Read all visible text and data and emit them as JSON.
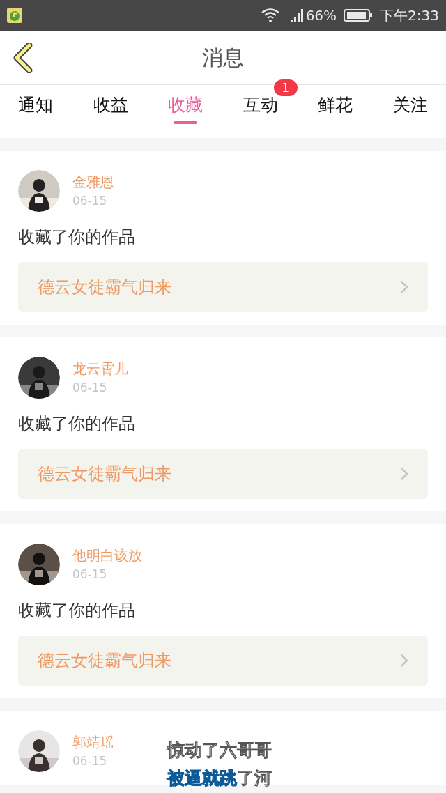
{
  "status_bar": {
    "battery": "66%",
    "time": "下午2:33"
  },
  "header": {
    "title": "消息"
  },
  "tabs": [
    {
      "label": "通知",
      "selected": false
    },
    {
      "label": "收益",
      "selected": false
    },
    {
      "label": "收藏",
      "selected": true
    },
    {
      "label": "互动",
      "selected": false,
      "badge": "1"
    },
    {
      "label": "鲜花",
      "selected": false
    },
    {
      "label": "关注",
      "selected": false
    }
  ],
  "messages": [
    {
      "name": "金雅恩",
      "date": "06-15",
      "action": "收藏了你的作品",
      "work": "德云女徒霸气归来"
    },
    {
      "name": "龙云霄儿",
      "date": "06-15",
      "action": "收藏了你的作品",
      "work": "德云女徒霸气归来"
    },
    {
      "name": "他明白该放",
      "date": "06-15",
      "action": "收藏了你的作品",
      "work": "德云女徒霸气归来"
    },
    {
      "name": "郭靖瑶",
      "date": "06-15"
    }
  ],
  "lyrics": [
    {
      "kind": "plain",
      "text": "惊动了六哥哥"
    },
    {
      "kind": "progress",
      "sung": "被逼就跳",
      "text": "了河"
    }
  ]
}
